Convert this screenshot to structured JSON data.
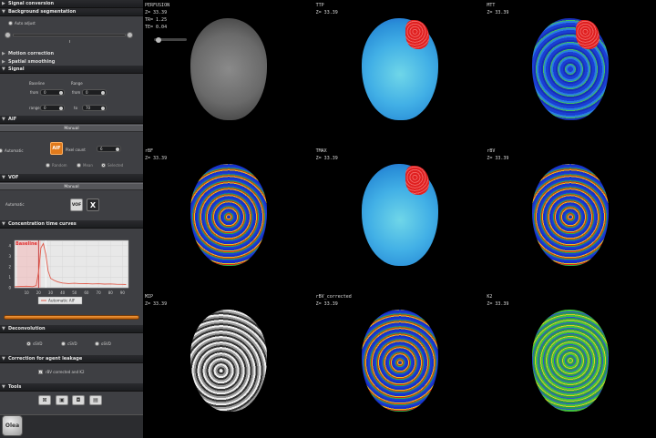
{
  "panel": {
    "sections": {
      "signal_conversion": "Signal conversion",
      "background_segmentation": "Background segmentation",
      "motion_correction": "Motion correction",
      "spatial_smoothing": "Spatial smoothing",
      "signal": "Signal",
      "aif": "AIF",
      "vof": "VOF",
      "ctc": "Concentration time curves",
      "deconvolution": "Deconvolution",
      "leakage": "Correction for agent leakage",
      "tools": "Tools"
    },
    "auto_adjust": "Auto adjust",
    "signal": {
      "baseline": "Baseline",
      "range": "Range",
      "from_label": "from",
      "range_label": "range",
      "to_label": "to",
      "from1": "0",
      "to1": "0",
      "range1": "0",
      "to2": "70"
    },
    "aif": {
      "header": "Manual",
      "automatic": "Automatic",
      "aif_button": "AIF",
      "pixel_count_label": "Pixel count",
      "pixel_count": "6",
      "options": [
        "Random",
        "Mean",
        "Selected"
      ],
      "selected_option": 2
    },
    "vof": {
      "header": "Manual",
      "automatic": "Automatic",
      "vof_button": "VOF",
      "x_button": "X"
    },
    "ctc": {
      "baseline_label": "Baseline",
      "legend": "Automatic AIF",
      "x_ticks": [
        "10",
        "20",
        "30",
        "40",
        "50",
        "60",
        "70",
        "80",
        "90"
      ],
      "y_ticks": [
        "4",
        "3",
        "2",
        "1",
        "0"
      ],
      "curve": [
        [
          0,
          0.1
        ],
        [
          10,
          0.15
        ],
        [
          15,
          0.1
        ],
        [
          18,
          0.2
        ],
        [
          20,
          1.5
        ],
        [
          22,
          3.8
        ],
        [
          24,
          4.2
        ],
        [
          26,
          3.2
        ],
        [
          28,
          1.6
        ],
        [
          30,
          0.9
        ],
        [
          33,
          0.7
        ],
        [
          36,
          0.55
        ],
        [
          40,
          0.45
        ],
        [
          45,
          0.4
        ],
        [
          50,
          0.42
        ],
        [
          55,
          0.38
        ],
        [
          60,
          0.4
        ],
        [
          65,
          0.36
        ],
        [
          70,
          0.38
        ],
        [
          75,
          0.35
        ],
        [
          80,
          0.36
        ],
        [
          85,
          0.33
        ],
        [
          90,
          0.32
        ],
        [
          93,
          0.3
        ]
      ],
      "series_color": "#e05a4a",
      "xlim": [
        0,
        95
      ],
      "ylim": [
        0,
        4.5
      ]
    },
    "deconvolution": {
      "options": [
        "sSVD",
        "cSVD",
        "oSVD"
      ],
      "selected": 0
    },
    "leakage": {
      "checkbox_label": "rBV corrected and K2",
      "checked": true
    },
    "logo": "Olea"
  },
  "viewer": {
    "cells": [
      {
        "title": "PERFUSION",
        "z": "Z=  33.39",
        "extra": [
          "TR=   1.25",
          "TE=   0.04"
        ],
        "map": "gray"
      },
      {
        "title": "TTP",
        "z": "Z=  33.39",
        "map": "ttp"
      },
      {
        "title": "MTT",
        "z": "Z=  33.39",
        "map": "mtt"
      },
      {
        "title": "rBF",
        "z": "Z=  33.39",
        "map": "rbf"
      },
      {
        "title": "TMAX",
        "z": "Z=  33.39",
        "map": "ttp"
      },
      {
        "title": "rBV",
        "z": "Z=  33.39",
        "map": "rbf"
      },
      {
        "title": "MIP",
        "z": "Z=  33.39",
        "map": "mip"
      },
      {
        "title": "rBV_corrected",
        "z": "Z=  33.39",
        "map": "rbf"
      },
      {
        "title": "K2",
        "z": "Z=  33.39",
        "map": "k2"
      }
    ]
  },
  "colors": {
    "accent_orange": "#e07a1c",
    "panel_bg": "#3e3f43",
    "section_bg": "#1f2023"
  }
}
